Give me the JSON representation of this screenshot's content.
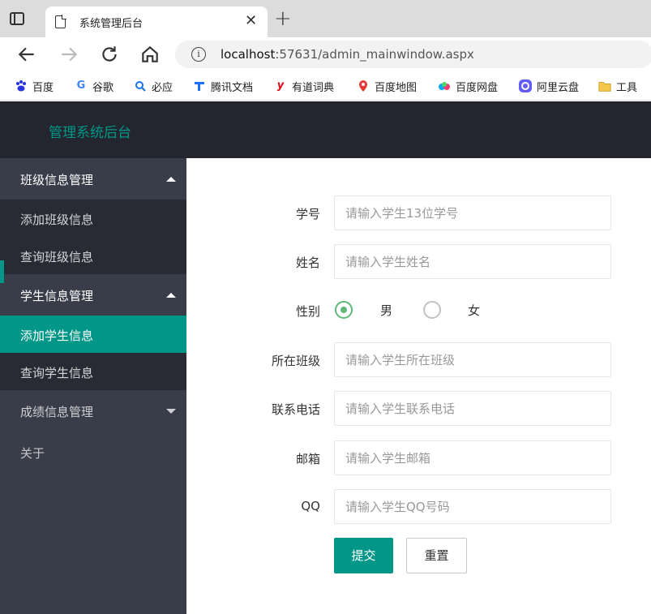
{
  "browser": {
    "tab_title": "系统管理后台",
    "url_host": "localhost",
    "url_rest": ":57631/admin_mainwindow.aspx",
    "bookmarks": [
      {
        "label": "百度",
        "icon": "baidu-paw-icon",
        "color": "#2932e1"
      },
      {
        "label": "谷歌",
        "icon": "google-g-icon",
        "color": "#4285f4"
      },
      {
        "label": "必应",
        "icon": "bing-search-icon",
        "color": "#1a73e8"
      },
      {
        "label": "腾讯文档",
        "icon": "tencent-docs-icon",
        "color": "#1e6fff"
      },
      {
        "label": "有道词典",
        "icon": "youdao-icon",
        "color": "#e60012"
      },
      {
        "label": "百度地图",
        "icon": "map-pin-icon",
        "color": "#e53935"
      },
      {
        "label": "百度网盘",
        "icon": "cloud-drive-icon",
        "color": "#06a7ff"
      },
      {
        "label": "阿里云盘",
        "icon": "aliyun-drive-icon",
        "color": "#635bff"
      },
      {
        "label": "工具",
        "icon": "folder-icon",
        "color": "#f2c94c"
      }
    ]
  },
  "app": {
    "logo": "管理系统后台",
    "accent": "#009688"
  },
  "sidebar": {
    "groups": [
      {
        "label": "班级信息管理",
        "expanded": true,
        "children": [
          "添加班级信息",
          "查询班级信息"
        ]
      },
      {
        "label": "学生信息管理",
        "expanded": true,
        "children": [
          "添加学生信息",
          "查询学生信息"
        ]
      },
      {
        "label": "成绩信息管理",
        "expanded": false,
        "children": []
      }
    ],
    "active_item": "添加学生信息",
    "about": "关于"
  },
  "form": {
    "fields": [
      {
        "label": "学号",
        "placeholder": "请输入学生13位学号",
        "value": ""
      },
      {
        "label": "姓名",
        "placeholder": "请输入学生姓名",
        "value": ""
      },
      {
        "label": "性别",
        "options": [
          "男",
          "女"
        ],
        "selected": "男"
      },
      {
        "label": "所在班级",
        "placeholder": "请输入学生所在班级",
        "value": ""
      },
      {
        "label": "联系电话",
        "placeholder": "请输入学生联系电话",
        "value": ""
      },
      {
        "label": "邮箱",
        "placeholder": "请输入学生邮箱",
        "value": ""
      },
      {
        "label": "QQ",
        "placeholder": "请输入学生QQ号码",
        "value": ""
      }
    ],
    "submit_label": "提交",
    "reset_label": "重置"
  }
}
